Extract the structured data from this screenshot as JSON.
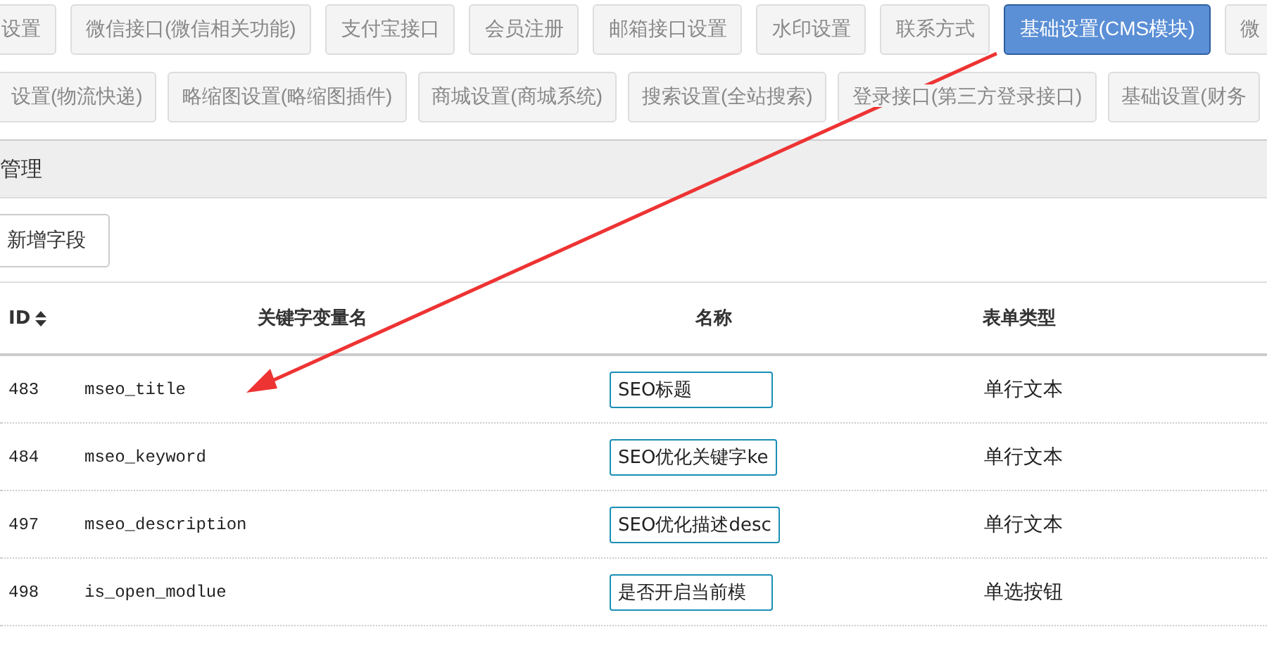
{
  "nav_rows": [
    [
      {
        "label": "设置",
        "selected": false
      },
      {
        "label": "微信接口(微信相关功能)",
        "selected": false
      },
      {
        "label": "支付宝接口",
        "selected": false
      },
      {
        "label": "会员注册",
        "selected": false
      },
      {
        "label": "邮箱接口设置",
        "selected": false
      },
      {
        "label": "水印设置",
        "selected": false
      },
      {
        "label": "联系方式",
        "selected": false
      },
      {
        "label": "基础设置(CMS模块)",
        "selected": true
      },
      {
        "label": "微",
        "selected": false
      }
    ],
    [
      {
        "label": "设置(物流快递)",
        "selected": false
      },
      {
        "label": "略缩图设置(略缩图插件)",
        "selected": false
      },
      {
        "label": "商城设置(商城系统)",
        "selected": false
      },
      {
        "label": "搜索设置(全站搜索)",
        "selected": false
      },
      {
        "label": "登录接口(第三方登录接口)",
        "selected": false
      },
      {
        "label": "基础设置(财务",
        "selected": false
      }
    ]
  ],
  "panel": {
    "title": "管理",
    "add_button": "新增字段"
  },
  "table": {
    "columns": [
      "ID",
      "关键字变量名",
      "名称",
      "表单类型"
    ],
    "rows": [
      {
        "id": "483",
        "key": "mseo_title",
        "name": "SEO标题",
        "type": "单行文本"
      },
      {
        "id": "484",
        "key": "mseo_keyword",
        "name": "SEO优化关键字ke",
        "type": "单行文本"
      },
      {
        "id": "497",
        "key": "mseo_description",
        "name": "SEO优化描述desc",
        "type": "单行文本"
      },
      {
        "id": "498",
        "key": "is_open_modlue",
        "name": "是否开启当前模",
        "type": "单选按钮"
      }
    ]
  }
}
